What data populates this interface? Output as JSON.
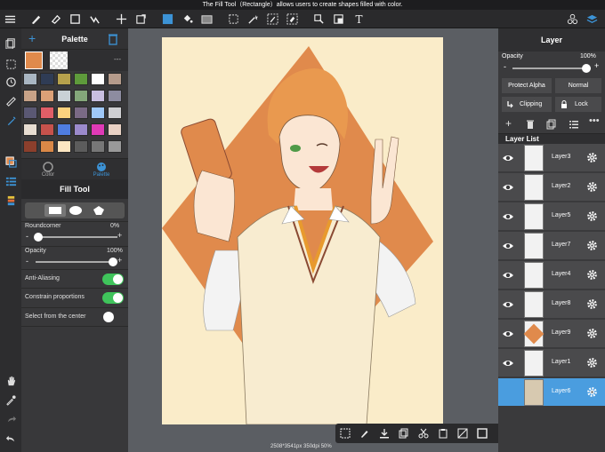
{
  "hint": "The Fill Tool（Rectangle）allows users to create shapes filled with color.",
  "toolbar": {
    "icons": [
      "menu-icon",
      "brush-icon",
      "eraser-icon",
      "rectangle-icon",
      "smudge-icon",
      "move-icon",
      "transform-icon",
      "color-icon",
      "fill-bucket-icon",
      "gradient-icon",
      "select-rect-icon",
      "magic-wand-icon",
      "select-pen-icon",
      "select-eraser-icon",
      "select-layer-icon",
      "transform-select-icon",
      "text-icon",
      "materials-icon",
      "layers-icon"
    ]
  },
  "palette": {
    "title": "Palette",
    "colors": [
      "#a9b6c2",
      "#2f3c55",
      "#b6a14c",
      "#5e9a3b",
      "#ffffff",
      "#b59b8b",
      "#c7a287",
      "#dba077",
      "#c9d1d6",
      "#84a77a",
      "#c9bfe0",
      "#8d8ca0",
      "#5a5873",
      "#e05e67",
      "#fcd27e",
      "#7a6a85",
      "#9fc8f7",
      "#cfcfd2",
      "#e7ddd1",
      "#c6524c",
      "#4f7de0",
      "#9b8acc",
      "#e03ab6",
      "#e9d1c4",
      "#8c3f2c",
      "#d98847",
      "#fde6c2",
      "#5c5c5c",
      "#777777",
      "#999999"
    ],
    "tabs": [
      "Color",
      "Palette"
    ],
    "active_tab": "Palette"
  },
  "fill_tool": {
    "title": "Fill Tool",
    "roundcorner_label": "Roundcorner",
    "roundcorner_value": "0%",
    "opacity_label": "Opacity",
    "opacity_value": "100%",
    "anti_aliasing_label": "Anti-Aliasing",
    "constrain_label": "Constrain proportions",
    "from_center_label": "Select from the center",
    "anti_aliasing_on": true,
    "constrain_on": true,
    "from_center_on": false,
    "minus": "-",
    "plus": "+"
  },
  "canvas": {
    "info": "2508*3541px 350dpi 50%",
    "paper_color": "#faecc9",
    "diamond_color": "#e08a4c"
  },
  "layer_panel": {
    "title": "Layer",
    "opacity_label": "Opacity",
    "opacity_value": "100%",
    "protect_alpha_label": "Protect Alpha",
    "blend_mode": "Normal",
    "clipping_label": "Clipping",
    "lock_label": "Lock",
    "list_label": "Layer List",
    "layers": [
      {
        "name": "Layer3",
        "visible": true,
        "selected": false
      },
      {
        "name": "Layer2",
        "visible": true,
        "selected": false
      },
      {
        "name": "Layer5",
        "visible": true,
        "selected": false
      },
      {
        "name": "Layer7",
        "visible": true,
        "selected": false
      },
      {
        "name": "Layer4",
        "visible": true,
        "selected": false
      },
      {
        "name": "Layer8",
        "visible": true,
        "selected": false
      },
      {
        "name": "Layer9",
        "visible": true,
        "selected": false
      },
      {
        "name": "Layer1",
        "visible": true,
        "selected": false
      },
      {
        "name": "Layer6",
        "visible": true,
        "selected": true
      }
    ]
  },
  "colors": {
    "accent": "#3c93d6",
    "selected_layer": "#4a9ddf",
    "toggle_on": "#3fc45b"
  }
}
